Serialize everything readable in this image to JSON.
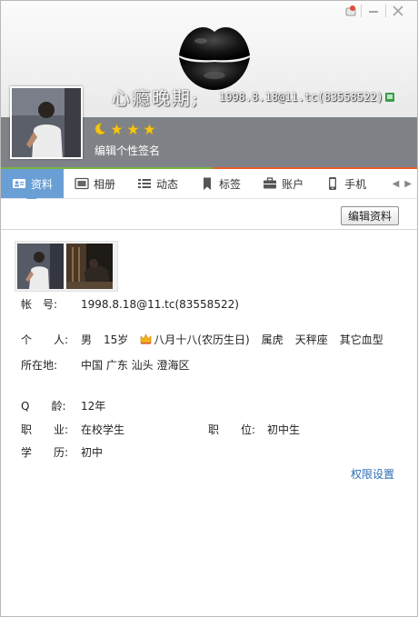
{
  "window": {
    "controls": [
      "skin",
      "minimize",
      "close"
    ]
  },
  "header": {
    "nickname": "心瘾晚期;",
    "account_line": "1998.8.18@11.tc(83558522)",
    "signature": "编辑个性签名",
    "level_icons": [
      "moon",
      "star",
      "star",
      "star"
    ],
    "colors": {
      "band": "#7f8387",
      "accent_green": "#7cb342",
      "accent_orange": "#e65a2b"
    }
  },
  "tabs": [
    {
      "label": "资料",
      "icon": "profile-card-icon",
      "active": true
    },
    {
      "label": "相册",
      "icon": "photo-album-icon",
      "active": false
    },
    {
      "label": "动态",
      "icon": "feed-list-icon",
      "active": false
    },
    {
      "label": "标签",
      "icon": "bookmark-tag-icon",
      "active": false
    },
    {
      "label": "账户",
      "icon": "wallet-icon",
      "active": false
    },
    {
      "label": "手机",
      "icon": "mobile-phone-icon",
      "active": false
    }
  ],
  "toolbar": {
    "edit_label": "编辑资料"
  },
  "profile": {
    "account": {
      "label": "帐　号:",
      "value": "1998.8.18@11.tc(83558522)"
    },
    "personal": {
      "label": "个　　人:",
      "gender": "男",
      "age": "15岁",
      "birthday": "八月十八(农历生日)",
      "zodiac": "属虎",
      "constellation": "天秤座",
      "blood": "其它血型"
    },
    "location": {
      "label": "所在地:",
      "value": "中国 广东 汕头 澄海区"
    },
    "q_age": {
      "label": "Q　　龄:",
      "value": "12年"
    },
    "job": {
      "label": "职　　业:",
      "value": "在校学生"
    },
    "position": {
      "label": "职　　位:",
      "value": "初中生"
    },
    "education": {
      "label": "学　　历:",
      "value": "初中"
    },
    "permission_link": "权限设置"
  }
}
